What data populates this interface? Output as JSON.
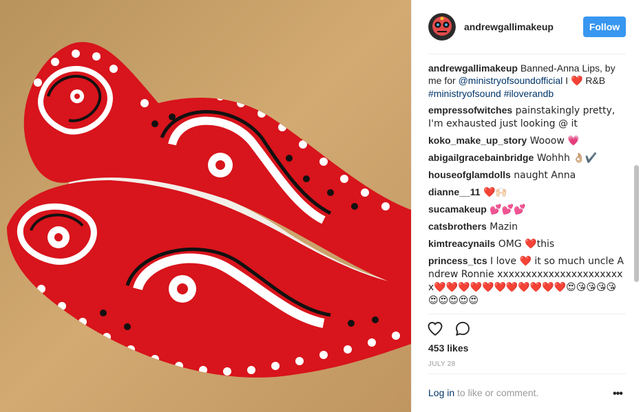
{
  "post": {
    "username": "andrewgallimakeup",
    "follow_label": "Follow",
    "likes": "453 likes",
    "date": "JULY 28",
    "login_link": "Log in",
    "login_rest": " to like or comment.",
    "more": "•••"
  },
  "caption": {
    "user": "andrewgallimakeup",
    "text_before": " Banned-Anna Lips, by me for ",
    "mention": "@ministryofsoundofficial",
    "text_mid": " I ",
    "heart": "❤️",
    "text_after": " R&B ",
    "tag1": "#ministryofsound",
    "space": " ",
    "tag2": "#iloverandb"
  },
  "comments": [
    {
      "user": "empressofwitches",
      "text": " painstakingly pretty, I'm exhausted just looking @ it"
    },
    {
      "user": "koko_make_up_story",
      "text": " Wooow 💗"
    },
    {
      "user": "abigailgracebainbridge",
      "text": " Wohhh 👌🏼✔️"
    },
    {
      "user": "houseofglamdolls",
      "text": " naught Anna"
    },
    {
      "user": "dianne__11",
      "text": " ❤️🙌🏻"
    },
    {
      "user": "sucamakeup",
      "text": " 💕💕💕"
    },
    {
      "user": "catsbrothers",
      "text": " Mazin"
    },
    {
      "user": "kimtreacynails",
      "text": " OMG ❤️this"
    },
    {
      "user": "princess_tcs",
      "text": " I love ❤️ it so much uncle Andrew Ronnie xxxxxxxxxxxxxxxxxxxxxxx❤️❤️❤️❤️❤️❤️❤️❤️❤️❤️❤️😍😘😘😘😘😍😍😍😍😍"
    }
  ],
  "icons": {
    "like": "heart-outline-icon",
    "comment": "speech-bubble-icon",
    "more": "ellipsis-icon"
  },
  "colors": {
    "follow_bg": "#3897f0",
    "link": "#003569",
    "lip_red": "#d8141c"
  }
}
